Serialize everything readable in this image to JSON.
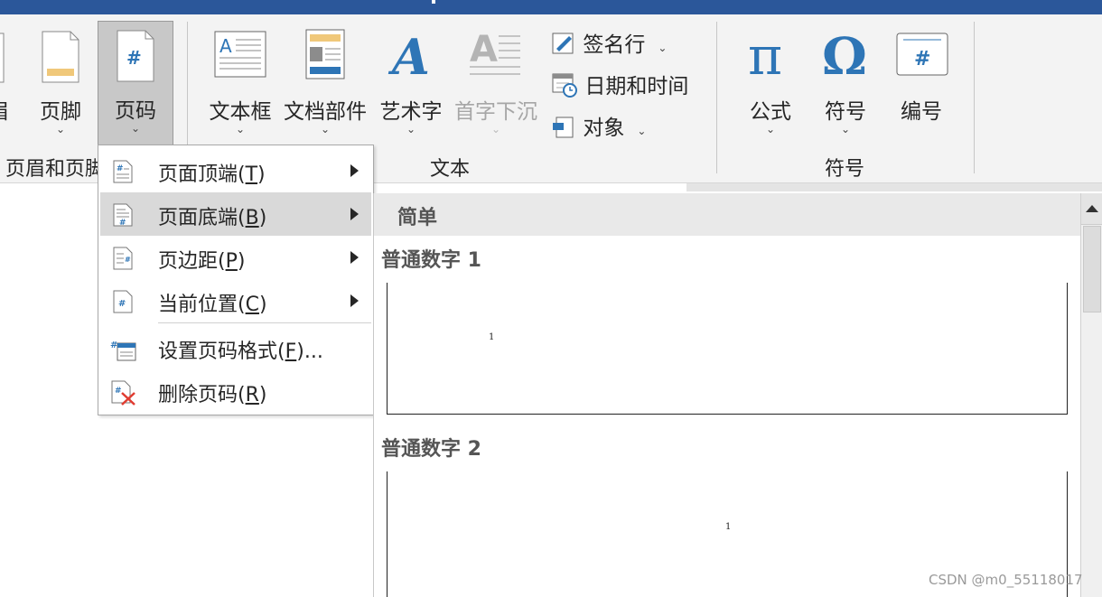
{
  "ribbon": {
    "header_footer_group": {
      "header_label_partial": "眉",
      "footer_label": "页脚",
      "page_number_label": "页码",
      "group_label": "页眉和页脚"
    },
    "text_group": {
      "textbox_label": "文本框",
      "quickparts_label": "文档部件",
      "wordart_label": "艺术字",
      "dropcap_label": "首字下沉",
      "signature_label": "签名行",
      "datetime_label": "日期和时间",
      "object_label": "对象",
      "group_label": "文本"
    },
    "symbols_group": {
      "equation_label": "公式",
      "symbol_label": "符号",
      "numbering_label": "编号",
      "group_label": "符号"
    }
  },
  "menu": {
    "items": [
      {
        "label": "页面顶端(",
        "key": "T",
        "suffix": ")"
      },
      {
        "label": "页面底端(",
        "key": "B",
        "suffix": ")"
      },
      {
        "label": "页边距(",
        "key": "P",
        "suffix": ")"
      },
      {
        "label": "当前位置(",
        "key": "C",
        "suffix": ")"
      },
      {
        "label": "设置页码格式(",
        "key": "F",
        "suffix": ")..."
      },
      {
        "label": "删除页码(",
        "key": "R",
        "suffix": ")"
      }
    ]
  },
  "gallery": {
    "section_header": "简单",
    "items": [
      {
        "title": "普通数字 1",
        "page_number": "1"
      },
      {
        "title": "普通数字 2",
        "page_number": "1"
      }
    ]
  },
  "watermark": "CSDN @m0_55118017",
  "colors": {
    "title_bar": "#2b579a",
    "ribbon_bg": "#f3f3f3",
    "accent_blue": "#2e75b6",
    "menu_highlight": "#d9d9d9",
    "delete_red": "#e03c31"
  }
}
